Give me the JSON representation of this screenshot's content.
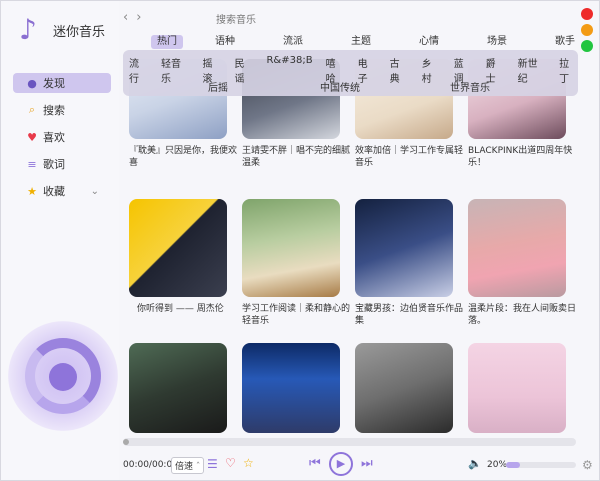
{
  "app": {
    "title": "迷你音乐",
    "logo_icon": "music-note-icon"
  },
  "sidebar": {
    "items": [
      {
        "label": "发现",
        "icon": "bulb-icon",
        "active": true
      },
      {
        "label": "搜索",
        "icon": "search-icon"
      },
      {
        "label": "喜欢",
        "icon": "heart-icon"
      },
      {
        "label": "歌词",
        "icon": "lyrics-icon"
      },
      {
        "label": "收藏",
        "icon": "star-icon",
        "expandable": true
      }
    ]
  },
  "topbar": {
    "search_placeholder": "搜索音乐",
    "window_dots": [
      "#ee2a2a",
      "#f39b15",
      "#22c540"
    ]
  },
  "tabs": [
    "热门",
    "语种",
    "流派",
    "主题",
    "心情",
    "场景",
    "歌手"
  ],
  "genres_row1": [
    "流行",
    "轻音乐",
    "摇滚",
    "民谣",
    "R&#38;B",
    "嘻哈",
    "电子",
    "古典",
    "乡村",
    "蓝调",
    "爵士",
    "新世纪",
    "拉丁"
  ],
  "genres_row2": [
    "后摇",
    "中国传统",
    "世界音乐"
  ],
  "cards": [
    {
      "caption": "『耽美』只因是你，我便欢喜"
    },
    {
      "caption": "王靖雯不胖｜唱不完的细腻温柔"
    },
    {
      "caption": "效率加倍｜学习工作专属轻音乐"
    },
    {
      "caption": "BLACKPINK出道四周年快乐！"
    },
    {
      "caption": "你听得到 —— 周杰伦"
    },
    {
      "caption": "学习工作阅读｜柔和静心的轻音乐"
    },
    {
      "caption": "宝藏男孩：边伯贤音乐作品集"
    },
    {
      "caption": "温柔片段：我在人间贩卖日落。"
    },
    {
      "caption": ""
    },
    {
      "caption": ""
    },
    {
      "caption": ""
    },
    {
      "caption": ""
    }
  ],
  "player": {
    "time": "00:00/00:00",
    "speed": "倍速",
    "volume": "20%",
    "progress": 0,
    "volume_level": 0.2,
    "accent": "#8e74da"
  }
}
